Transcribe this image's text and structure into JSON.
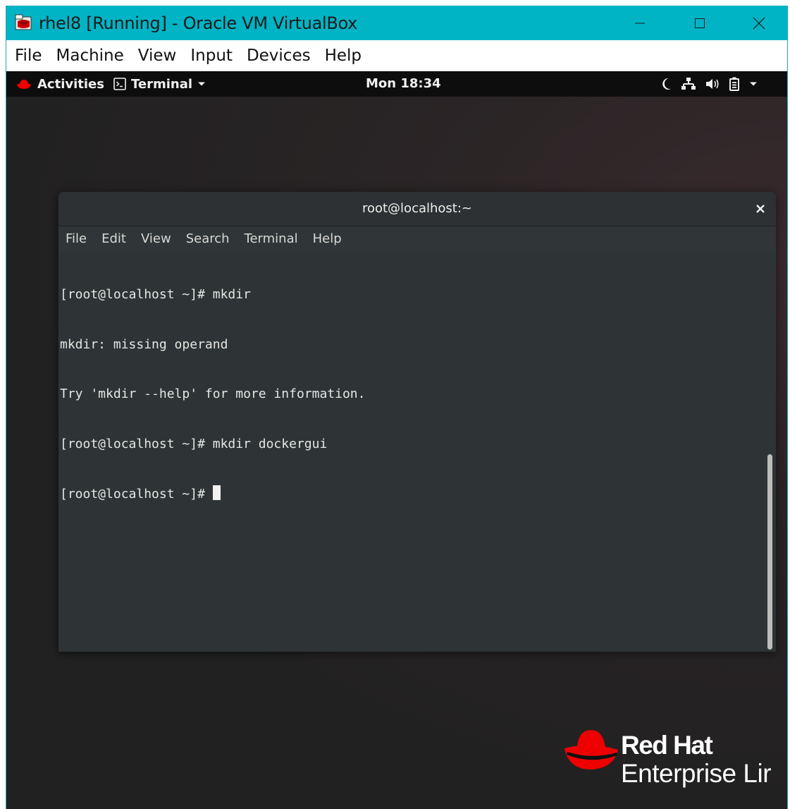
{
  "window": {
    "title": "rhel8 [Running] - Oracle VM VirtualBox",
    "accent": "#00b4c5"
  },
  "menubar": {
    "items": [
      "File",
      "Machine",
      "View",
      "Input",
      "Devices",
      "Help"
    ]
  },
  "gnome_topbar": {
    "activities": "Activities",
    "app_menu": "Terminal",
    "clock": "Mon 18:34"
  },
  "terminal": {
    "title": "root@localhost:~",
    "menu": [
      "File",
      "Edit",
      "View",
      "Search",
      "Terminal",
      "Help"
    ],
    "lines": [
      "[root@localhost ~]# mkdir",
      "mkdir: missing operand",
      "Try 'mkdir --help' for more information.",
      "[root@localhost ~]# mkdir dockergui"
    ],
    "prompt": "[root@localhost ~]# "
  },
  "branding": {
    "line1": "Red Hat",
    "line2": "Enterprise Lir",
    "color": "#ee0000"
  }
}
